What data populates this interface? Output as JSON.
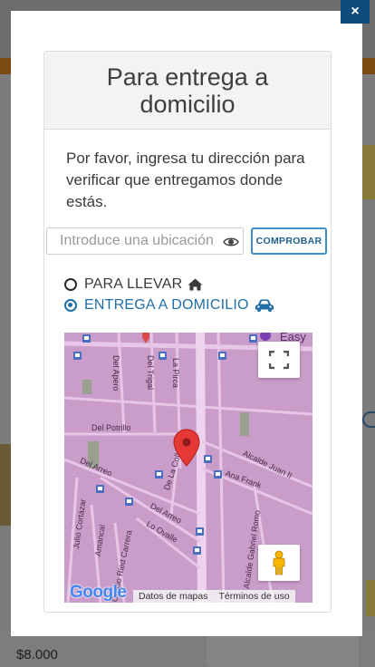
{
  "modal": {
    "close_label": "×",
    "title": "Para entrega a domicilio",
    "description": "Por favor, ingresa tu dirección para verificar que entregamos donde estás.",
    "search": {
      "placeholder": "Introduce una ubicación",
      "value": ""
    },
    "check_button": "COMPROBAR",
    "options": {
      "pickup": {
        "label": "PARA LLEVAR",
        "icon": "home-icon",
        "selected": false
      },
      "delivery": {
        "label": "ENTREGA A DOMICILIO",
        "icon": "car-icon",
        "selected": true
      }
    },
    "map": {
      "streets": {
        "del_apero": "Del Apero",
        "del_trigal": "Del Trigal",
        "la_pirca": "La Pirca",
        "del_potrillo": "Del Potrillo",
        "del_arreo_1": "Del Arreo",
        "del_arreo_2": "Del Arreo",
        "de_la_colla": "De La Colla",
        "alcalde_juan": "Alcalde Juan II",
        "ana_frank": "Ana Frank",
        "julio_cortazar": "Julio Cortázar",
        "amancai": "Amancai",
        "oracio_ried": "Oracio Ried Carrera",
        "lo_ovalle": "Lo Ovalle",
        "alcalde_gabriel": "Alcalde Gabriel Romo",
        "easy": "Easy"
      },
      "logo": "Google",
      "map_data_label": "Datos de mapas",
      "terms_label": "Términos de uso"
    }
  },
  "background": {
    "price": "$8.000"
  },
  "colors": {
    "accent": "#1f6fa7",
    "close_bg": "#0f4a78",
    "map_bg": "#c79ac7",
    "marker": "#e53935"
  }
}
